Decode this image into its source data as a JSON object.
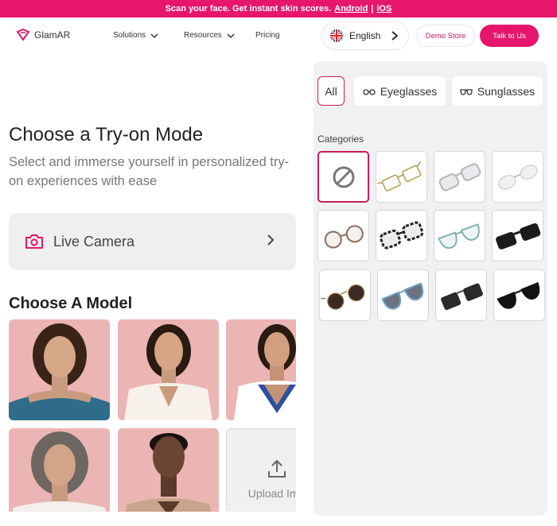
{
  "banner": {
    "text": "Scan your face. Get instant skin scores.",
    "android": "Android",
    "separator": "|",
    "ios": "iOS"
  },
  "nav": {
    "brand": "GlamAR",
    "solutions": "Solutions",
    "resources": "Resources",
    "pricing": "Pricing",
    "language": "English",
    "demo_store": "Demo Store",
    "talk": "Talk to Us"
  },
  "main": {
    "title": "Choose a Try-on Mode",
    "subtitle": "Select and immerse yourself in personalized try-on experiences with ease",
    "live_camera": "Live Camera",
    "choose_model": "Choose A Model",
    "upload": "Upload Ima"
  },
  "panel": {
    "filters": [
      "All",
      "Eyeglasses",
      "Sunglasses"
    ],
    "categories_label": "Categories"
  },
  "colors": {
    "brand": "#e5166b",
    "accent_text": "#c81d5d"
  }
}
